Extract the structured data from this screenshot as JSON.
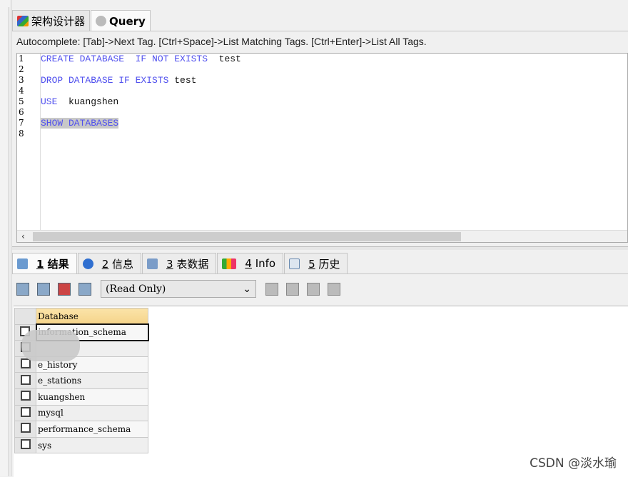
{
  "tabs": [
    {
      "label": "架构设计器",
      "icon": "schema-designer-icon"
    },
    {
      "label": "Query",
      "icon": "query-icon",
      "active": true
    }
  ],
  "autocomplete": "Autocomplete: [Tab]->Next Tag. [Ctrl+Space]->List Matching Tags. [Ctrl+Enter]->List All Tags.",
  "editor": {
    "line_numbers": [
      "1",
      "2",
      "3",
      "4",
      "5",
      "6",
      "7",
      "8"
    ],
    "lines": [
      {
        "kw": "CREATE DATABASE  IF NOT EXISTS",
        "id": "  test"
      },
      {
        "kw": "",
        "id": ""
      },
      {
        "kw": "DROP DATABASE IF EXISTS",
        "id": " test"
      },
      {
        "kw": "",
        "id": ""
      },
      {
        "kw": "USE",
        "id": "  kuangshen"
      },
      {
        "kw": "",
        "id": ""
      },
      {
        "kw": "SHOW DATABASES",
        "id": ""
      },
      {
        "kw": "",
        "id": ""
      }
    ]
  },
  "result_tabs": [
    {
      "num": "1",
      "label": "结果",
      "icon": "result-icon",
      "active": true
    },
    {
      "num": "2",
      "label": "信息",
      "icon": "info-circle-icon"
    },
    {
      "num": "3",
      "label": "表数据",
      "icon": "table-data-icon"
    },
    {
      "num": "4",
      "label": "Info",
      "icon": "shapes-icon"
    },
    {
      "num": "5",
      "label": "历史",
      "icon": "calendar-icon"
    }
  ],
  "readonly_select": "(Read Only)",
  "grid": {
    "header": "Database",
    "rows": [
      "information_schema",
      "",
      "e_history",
      "e_stations",
      "kuangshen",
      "mysql",
      "performance_schema",
      "sys"
    ]
  },
  "watermark": "CSDN @淡水瑜",
  "colors": {
    "keyword": "#5050ee",
    "header": "#f5d48a"
  }
}
